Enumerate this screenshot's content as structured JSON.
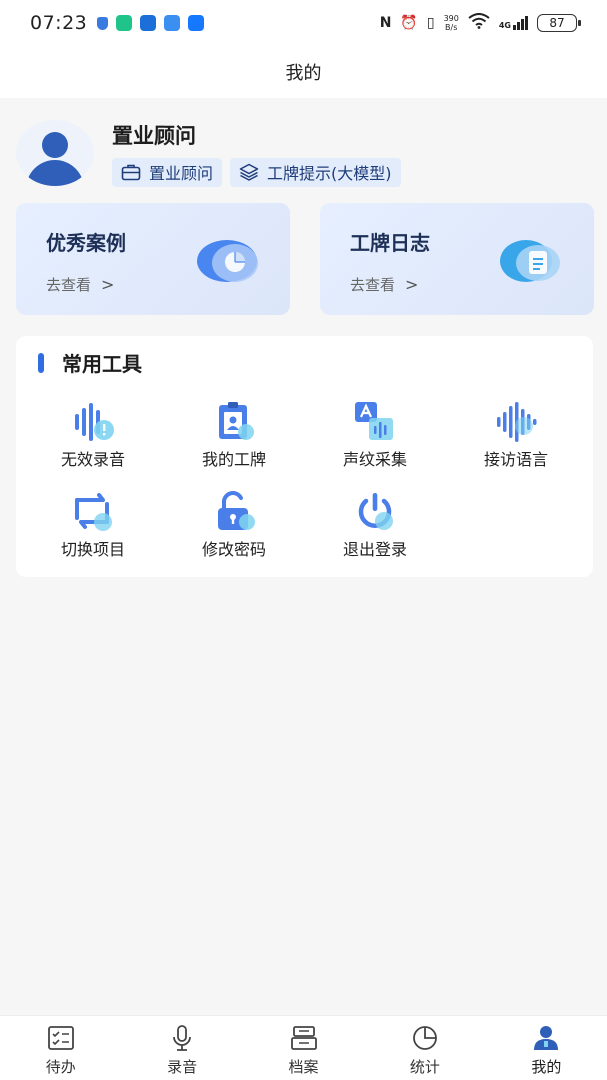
{
  "status_bar": {
    "time": "07:23",
    "net_speed_value": "390",
    "net_speed_unit": "B/s",
    "network": "4G",
    "battery": "87"
  },
  "header": {
    "title": "我的"
  },
  "profile": {
    "name": "置业顾问",
    "tags": [
      "置业顾问",
      "工牌提示(大模型)"
    ]
  },
  "cards": [
    {
      "title": "优秀案例",
      "sub": "去查看"
    },
    {
      "title": "工牌日志",
      "sub": "去查看"
    }
  ],
  "tools": {
    "title": "常用工具",
    "items": [
      {
        "label": "无效录音",
        "icon": "invalid-recording-icon"
      },
      {
        "label": "我的工牌",
        "icon": "badge-icon"
      },
      {
        "label": "声纹采集",
        "icon": "voiceprint-icon"
      },
      {
        "label": "接访语言",
        "icon": "soundwave-icon"
      },
      {
        "label": "切换项目",
        "icon": "switch-icon"
      },
      {
        "label": "修改密码",
        "icon": "lock-icon"
      },
      {
        "label": "退出登录",
        "icon": "power-icon"
      }
    ]
  },
  "bottom_nav": {
    "items": [
      {
        "label": "待办",
        "icon": "todo-icon"
      },
      {
        "label": "录音",
        "icon": "microphone-icon"
      },
      {
        "label": "档案",
        "icon": "archive-icon"
      },
      {
        "label": "统计",
        "icon": "pie-chart-icon"
      },
      {
        "label": "我的",
        "icon": "user-icon"
      }
    ],
    "active": "我的"
  },
  "colors": {
    "accent": "#2f6de1",
    "icon_blue": "#4a7ee8",
    "icon_light": "#7fd3f0",
    "card_bg": "#e2ebfc"
  }
}
